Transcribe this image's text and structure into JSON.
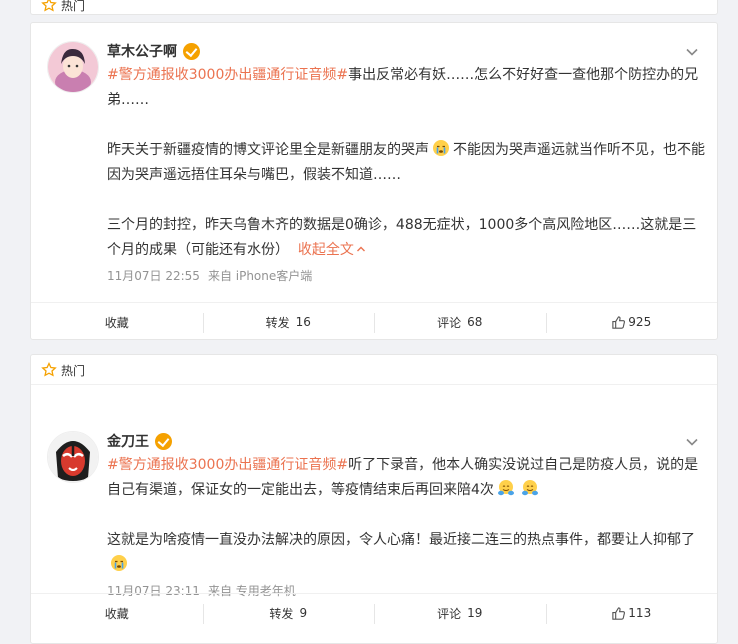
{
  "hot_label": "热门",
  "posts": [
    {
      "username": "草木公子啊",
      "topic": "#警方通报收3000办出疆通行证音频#",
      "paragraphs": [
        "事出反常必有妖……怎么不好好查一查他那个防控办的兄弟……",
        "昨天关于新疆疫情的博文评论里全是新疆朋友的哭声",
        "不能因为哭声遥远就当作听不见，也不能因为哭声遥远捂住耳朵与嘴巴，假装不知道……",
        "三个月的封控，昨天乌鲁木齐的数据是0确诊，488无症状，1000多个高风险地区……这就是三个月的成果（可能还有水份）",
        "收起全文"
      ],
      "time": "11月07日 22:55",
      "source": "来自 iPhone客户端",
      "actions": {
        "favorite": "收藏",
        "repost": "转发",
        "repost_count": "16",
        "comment": "评论",
        "comment_count": "68",
        "like_count": "925"
      }
    },
    {
      "username": "金刀王",
      "topic": "#警方通报收3000办出疆通行证音频#",
      "paragraphs": [
        "听了下录音，他本人确实没说过自己是防疫人员，说的是自己有渠道，保证女的一定能出去，等疫情结束后再回来陪4次",
        "这就是为啥疫情一直没办法解决的原因，令人心痛！最近接二连三的热点事件，都要让人抑郁了"
      ],
      "time": "11月07日 23:11",
      "source": "来自 专用老年机",
      "actions": {
        "favorite": "收藏",
        "repost": "转发",
        "repost_count": "9",
        "comment": "评论",
        "comment_count": "19",
        "like_count": "113"
      }
    }
  ],
  "colors": {
    "topic": "#eb7350",
    "meta": "#939393",
    "badge": "#f5a100"
  }
}
